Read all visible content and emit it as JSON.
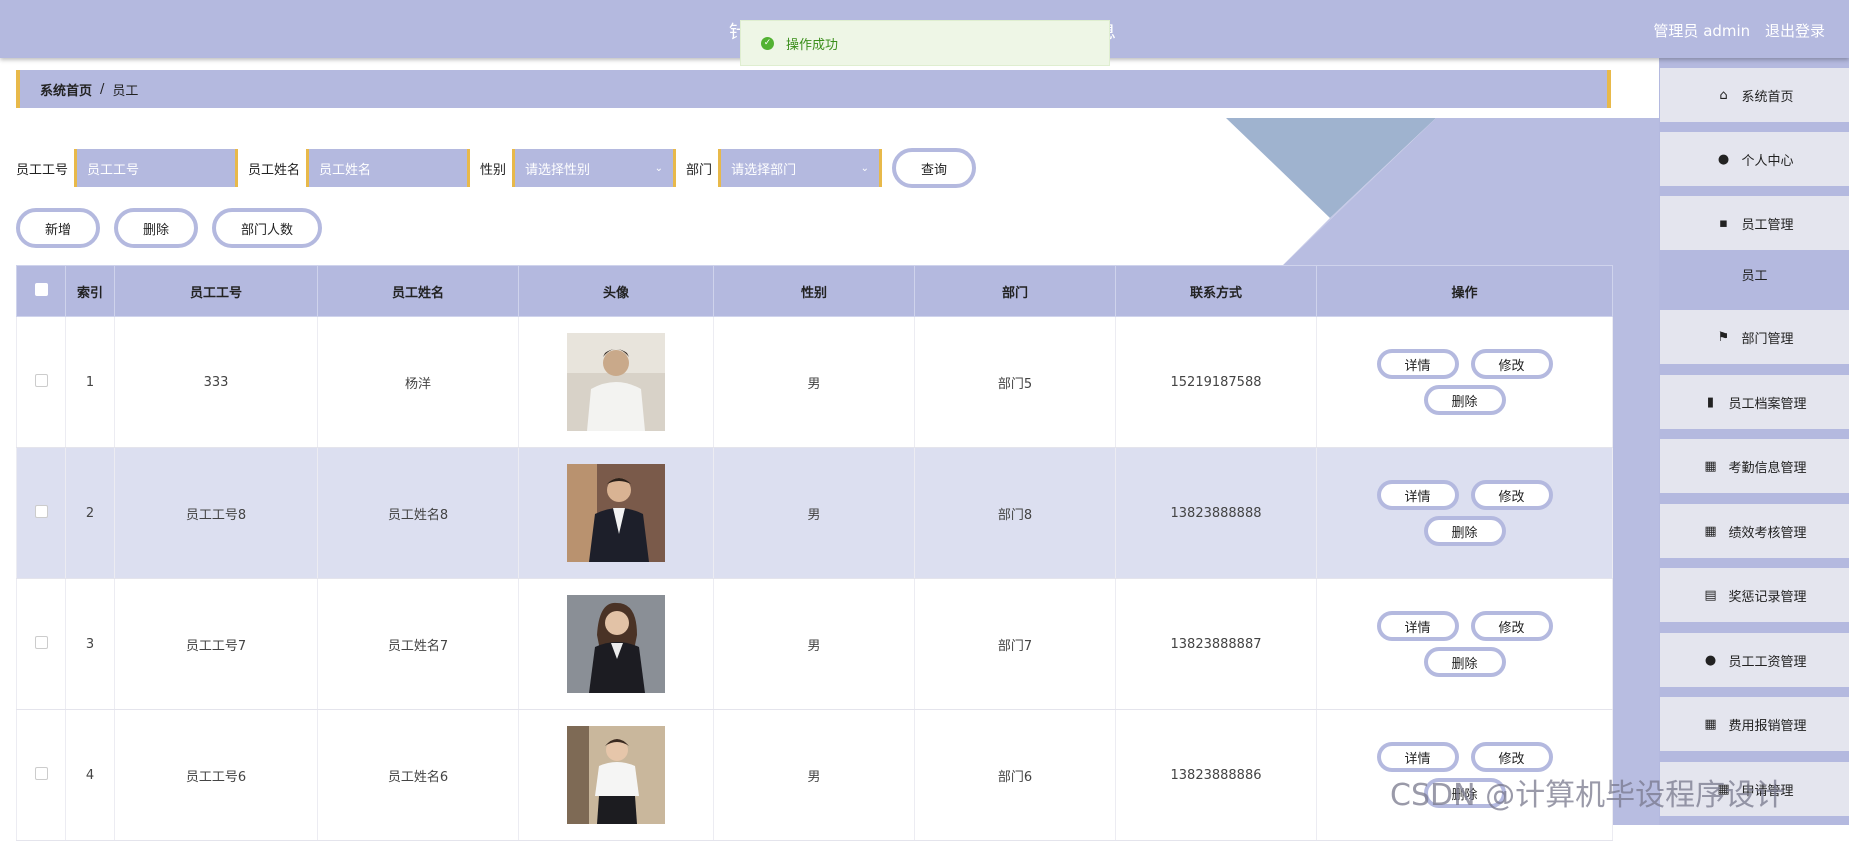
{
  "header": {
    "title_left": "针",
    "title_right": "息",
    "user_label": "管理员 admin",
    "logout_label": "退出登录"
  },
  "toast": {
    "message": "操作成功"
  },
  "breadcrumb": {
    "home": "系统首页",
    "separator": "/",
    "current": "员工"
  },
  "search": {
    "emp_no_label": "员工工号",
    "emp_no_placeholder": "员工工号",
    "emp_name_label": "员工姓名",
    "emp_name_placeholder": "员工姓名",
    "gender_label": "性别",
    "gender_placeholder": "请选择性别",
    "dept_label": "部门",
    "dept_placeholder": "请选择部门",
    "query_button": "查询"
  },
  "actions": {
    "add": "新增",
    "delete": "删除",
    "dept_count": "部门人数"
  },
  "table": {
    "headers": [
      "索引",
      "员工工号",
      "员工姓名",
      "头像",
      "性别",
      "部门",
      "联系方式",
      "操作"
    ],
    "op_labels": {
      "detail": "详情",
      "edit": "修改",
      "delete": "删除"
    },
    "rows": [
      {
        "index": "1",
        "emp_no": "333",
        "name": "杨洋",
        "gender": "男",
        "dept": "部门5",
        "phone": "15219187588"
      },
      {
        "index": "2",
        "emp_no": "员工工号8",
        "name": "员工姓名8",
        "gender": "男",
        "dept": "部门8",
        "phone": "13823888888"
      },
      {
        "index": "3",
        "emp_no": "员工工号7",
        "name": "员工姓名7",
        "gender": "男",
        "dept": "部门7",
        "phone": "13823888887"
      },
      {
        "index": "4",
        "emp_no": "员工工号6",
        "name": "员工姓名6",
        "gender": "男",
        "dept": "部门6",
        "phone": "13823888886"
      }
    ]
  },
  "sidebar": {
    "items": [
      {
        "label": "系统首页",
        "icon": "home-icon"
      },
      {
        "label": "个人中心",
        "icon": "user-icon"
      },
      {
        "label": "员工管理",
        "icon": "chat-icon"
      },
      {
        "label": "员工",
        "icon": ""
      },
      {
        "label": "部门管理",
        "icon": "flag-icon"
      },
      {
        "label": "员工档案管理",
        "icon": "bar-chart-icon"
      },
      {
        "label": "考勤信息管理",
        "icon": "grid-icon"
      },
      {
        "label": "绩效考核管理",
        "icon": "grid-icon"
      },
      {
        "label": "奖惩记录管理",
        "icon": "clipboard-icon"
      },
      {
        "label": "员工工资管理",
        "icon": "bulb-icon"
      },
      {
        "label": "费用报销管理",
        "icon": "grid-icon"
      },
      {
        "label": "申请管理",
        "icon": "grid-icon"
      }
    ]
  },
  "watermark": "CSDN @计算机毕设程序设计",
  "colors": {
    "accent": "#b4b9df",
    "highlight": "#e8b94a",
    "success": "#52b232"
  }
}
